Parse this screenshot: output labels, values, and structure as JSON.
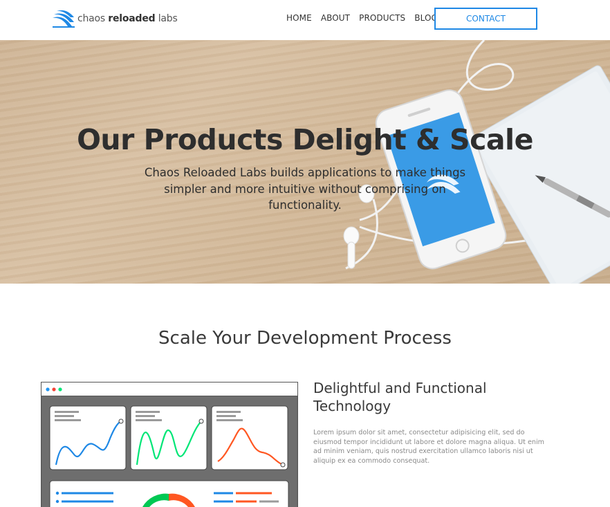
{
  "brand": {
    "name_light": "chaos ",
    "name_bold": "reloaded",
    "name_suffix": " labs",
    "accent": "#1e88e5"
  },
  "nav": {
    "items": [
      {
        "label": "HOME"
      },
      {
        "label": "ABOUT"
      },
      {
        "label": "PRODUCTS"
      },
      {
        "label": "BLOG"
      }
    ],
    "contact_label": "CONTACT"
  },
  "hero": {
    "title": "Our Products Delight & Scale",
    "subtitle": "Chaos Reloaded Labs builds applications to make things simpler and more intuitive without comprising on functionality."
  },
  "section": {
    "title": "Scale Your Development Process"
  },
  "feature": {
    "title": "Delightful and Functional Technology",
    "text": "Lorem ipsum dolor sit amet, consectetur adipisicing elit, sed do eiusmod tempor incididunt ut labore et dolore magna aliqua. Ut enim ad minim veniam, quis nostrud exercitation ullamco laboris nisi ut aliquip ex ea commodo consequat."
  },
  "dashboard": {
    "window_dots": [
      "#2196f3",
      "#f44336",
      "#00e676"
    ],
    "line_colors": [
      "#1e88e5",
      "#00e676",
      "#ff5722"
    ]
  }
}
